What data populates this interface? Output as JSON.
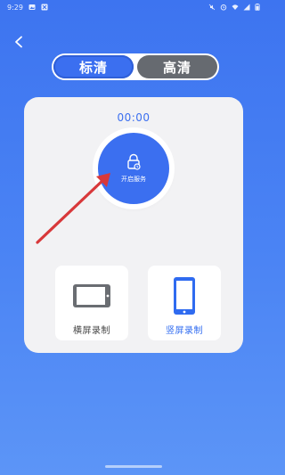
{
  "status_bar": {
    "time": "9:29"
  },
  "quality_tabs": [
    {
      "label": "标清",
      "active": true
    },
    {
      "label": "高清",
      "active": false
    }
  ],
  "timer": "00:00",
  "start_service_label": "开启服务",
  "modes": {
    "landscape": {
      "label": "横屏录制",
      "icon": "phone-landscape-icon"
    },
    "portrait": {
      "label": "竖屏录制",
      "icon": "phone-portrait-icon",
      "selected": true
    }
  },
  "colors": {
    "accent": "#3b6ff0",
    "inactive_tab": "#666a70",
    "arrow": "#d8383a"
  }
}
